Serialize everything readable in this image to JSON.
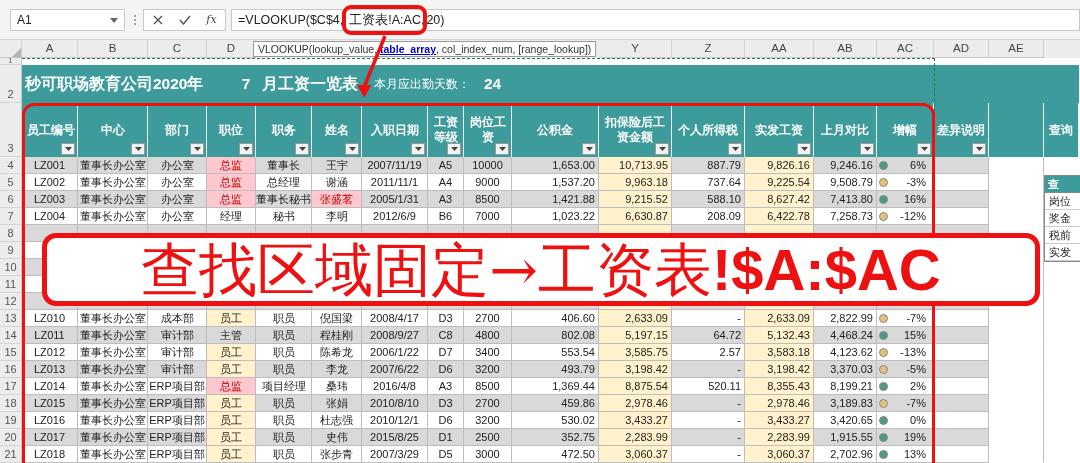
{
  "name_box": "A1",
  "formula_bar": {
    "function_button": "fx",
    "formula": "=VLOOKUP($C$4,工资表!A:AC,20)"
  },
  "tooltip": "VLOOKUP(lookup_value, **table_array**, col_index_num, [range_lookup])",
  "sheet": {
    "columns": [
      {
        "letter": "A",
        "header": "员工编号",
        "filter": true
      },
      {
        "letter": "B",
        "header": "中心",
        "filter": true
      },
      {
        "letter": "C",
        "header": "部门",
        "filter": true
      },
      {
        "letter": "D",
        "header": "职位",
        "filter": true
      },
      {
        "header": "职务",
        "filter": true
      },
      {
        "header": "姓名",
        "filter": true
      },
      {
        "header": "入职日期",
        "filter": true
      },
      {
        "header": "工资等级",
        "filter": true
      },
      {
        "header": "岗位工资",
        "filter": true
      },
      {
        "header": "公积金",
        "filter": true
      },
      {
        "letter": "Y",
        "header": "扣保险后工资金额",
        "filter": true
      },
      {
        "letter": "Z",
        "header": "个人所得税",
        "filter": true
      },
      {
        "letter": "AA",
        "header": "实发工资",
        "filter": true
      },
      {
        "letter": "AB",
        "header": "上月对比",
        "filter": true
      },
      {
        "letter": "AC",
        "header": "增幅",
        "filter": true
      },
      {
        "letter": "AD",
        "header": "差异说明",
        "filter": true
      },
      {
        "letter": "AE",
        "filter": false
      },
      {
        "header": "查询",
        "filter": false
      }
    ],
    "row_numbers": [
      "1",
      "2",
      "3"
    ],
    "title": {
      "company": "秒可职场教育公司2020年",
      "month": "7",
      "label": "月工资一览表",
      "days_label": "本月应出勤天数：",
      "days": "24"
    },
    "rows": [
      {
        "kind": "data",
        "number": "4",
        "shaded": true,
        "id": "LZ001",
        "center": "董事长办公室",
        "dept": "办公室",
        "position": {
          "text": "总监",
          "color": "#ffc7ce",
          "alert": true
        },
        "duty": "董事长",
        "name": {
          "text": "王宇"
        },
        "hire_date": "2007/11/19",
        "grade": "A5",
        "base_pay": "10000",
        "fund": "1,653.00",
        "after_insurance": "10,713.95",
        "tax": "887.79",
        "net_pay": "9,826.16",
        "last_month": "9,246.16",
        "growth": {
          "text": "6%",
          "color": "#4e9a82"
        }
      },
      {
        "kind": "data",
        "number": "5",
        "shaded": false,
        "id": "LZ002",
        "center": "董事长办公室",
        "dept": "办公室",
        "position": {
          "text": "总监",
          "color": "#ffc7ce",
          "alert": true
        },
        "duty": "总经理",
        "name": {
          "text": "谢涵"
        },
        "hire_date": "2011/11/1",
        "grade": "A4",
        "base_pay": "9000",
        "fund": "1,537.20",
        "after_insurance": "9,963.18",
        "tax": "737.64",
        "net_pay": "9,225.54",
        "last_month": "9,508.79",
        "growth": {
          "text": "-3%",
          "color": "#e6c07a"
        }
      },
      {
        "kind": "data",
        "number": "6",
        "shaded": true,
        "id": "LZ003",
        "center": "董事长办公室",
        "dept": "办公室",
        "position": {
          "text": "总监",
          "color": "#ffc7ce",
          "alert": true
        },
        "duty": "董事长秘书",
        "name": {
          "text": "张盛茗",
          "color": "#ffc7ce",
          "alert": true
        },
        "hire_date": "2005/1/31",
        "grade": "A3",
        "base_pay": "8500",
        "fund": "1,421.88",
        "after_insurance": "9,215.52",
        "tax": "588.10",
        "net_pay": "8,627.42",
        "last_month": "7,413.80",
        "growth": {
          "text": "16%",
          "color": "#4e9a82"
        }
      },
      {
        "kind": "data",
        "number": "7",
        "shaded": false,
        "id": "LZ004",
        "center": "董事长办公室",
        "dept": "办公室",
        "position": {
          "text": "经理"
        },
        "duty": "秘书",
        "name": {
          "text": "李明"
        },
        "hire_date": "2012/6/9",
        "grade": "B6",
        "base_pay": "7000",
        "fund": "1,023.22",
        "after_insurance": "6,630.87",
        "tax": "208.09",
        "net_pay": "6,422.78",
        "last_month": "7,258.73",
        "growth": {
          "text": "-12%",
          "color": "#e6c07a"
        }
      },
      {
        "kind": "covered",
        "number": "8",
        "shaded": true
      },
      {
        "kind": "covered",
        "number": "9",
        "shaded": false
      },
      {
        "kind": "covered",
        "number": "10",
        "shaded": true
      },
      {
        "kind": "covered",
        "number": "11",
        "shaded": false
      },
      {
        "kind": "covered",
        "number": "12",
        "shaded": true
      },
      {
        "kind": "data",
        "number": "13",
        "shaded": false,
        "id": "LZ010",
        "center": "董事长办公室",
        "dept": "成本部",
        "position": {
          "text": "员工",
          "color": "#fff2cc"
        },
        "duty": "职员",
        "name": {
          "text": "倪国梁"
        },
        "hire_date": "2008/4/17",
        "grade": "D3",
        "base_pay": "2700",
        "fund": "406.60",
        "after_insurance": "2,633.09",
        "tax": "-",
        "net_pay": "2,633.09",
        "last_month": "2,822.99",
        "growth": {
          "text": "-7%",
          "color": "#e6c07a"
        }
      },
      {
        "kind": "data",
        "number": "14",
        "shaded": true,
        "id": "LZ011",
        "center": "董事长办公室",
        "dept": "审计部",
        "position": {
          "text": "主管"
        },
        "duty": "职员",
        "name": {
          "text": "程桂刚"
        },
        "hire_date": "2008/9/27",
        "grade": "C8",
        "base_pay": "4800",
        "fund": "802.08",
        "after_insurance": "5,197.15",
        "tax": "64.72",
        "net_pay": "5,132.43",
        "last_month": "4,468.24",
        "growth": {
          "text": "15%",
          "color": "#4e9a82"
        }
      },
      {
        "kind": "data",
        "number": "15",
        "shaded": false,
        "id": "LZ012",
        "center": "董事长办公室",
        "dept": "审计部",
        "position": {
          "text": "员工",
          "color": "#fff2cc"
        },
        "duty": "职员",
        "name": {
          "text": "陈希龙"
        },
        "hire_date": "2006/1/22",
        "grade": "D7",
        "base_pay": "3400",
        "fund": "553.54",
        "after_insurance": "3,585.75",
        "tax": "2.57",
        "net_pay": "3,583.18",
        "last_month": "4,123.62",
        "growth": {
          "text": "-13%",
          "color": "#e6c07a"
        }
      },
      {
        "kind": "data",
        "number": "16",
        "shaded": true,
        "id": "LZ013",
        "center": "董事长办公室",
        "dept": "审计部",
        "position": {
          "text": "员工",
          "color": "#fff2cc"
        },
        "duty": "职员",
        "name": {
          "text": "李龙"
        },
        "hire_date": "2007/6/22",
        "grade": "D6",
        "base_pay": "3200",
        "fund": "493.79",
        "after_insurance": "3,198.42",
        "tax": "-",
        "net_pay": "3,198.42",
        "last_month": "3,370.03",
        "growth": {
          "text": "-5%",
          "color": "#e6c07a"
        }
      },
      {
        "kind": "data",
        "number": "17",
        "shaded": false,
        "id": "LZ014",
        "center": "董事长办公室",
        "dept": "ERP项目部",
        "position": {
          "text": "总监",
          "color": "#ffc7ce",
          "alert": true
        },
        "duty": "项目经理",
        "name": {
          "text": "桑玮"
        },
        "hire_date": "2016/4/8",
        "grade": "A3",
        "base_pay": "8500",
        "fund": "1,369.44",
        "after_insurance": "8,875.54",
        "tax": "520.11",
        "net_pay": "8,355.43",
        "last_month": "8,199.21",
        "growth": {
          "text": "2%",
          "color": "#4e9a82"
        }
      },
      {
        "kind": "data",
        "number": "18",
        "shaded": true,
        "id": "LZ015",
        "center": "董事长办公室",
        "dept": "ERP项目部",
        "position": {
          "text": "员工",
          "color": "#fff2cc"
        },
        "duty": "职员",
        "name": {
          "text": "张娟"
        },
        "hire_date": "2010/8/10",
        "grade": "D3",
        "base_pay": "2700",
        "fund": "459.86",
        "after_insurance": "2,978.46",
        "tax": "-",
        "net_pay": "2,978.46",
        "last_month": "3,189.83",
        "growth": {
          "text": "-7%",
          "color": "#e6c07a"
        }
      },
      {
        "kind": "data",
        "number": "19",
        "shaded": false,
        "id": "LZ016",
        "center": "董事长办公室",
        "dept": "ERP项目部",
        "position": {
          "text": "员工",
          "color": "#fff2cc"
        },
        "duty": "职员",
        "name": {
          "text": "杜志强"
        },
        "hire_date": "2010/12/1",
        "grade": "D6",
        "base_pay": "3200",
        "fund": "530.02",
        "after_insurance": "3,433.27",
        "tax": "-",
        "net_pay": "3,433.27",
        "last_month": "3,420.65",
        "growth": {
          "text": "0%",
          "color": "#4e9a82"
        }
      },
      {
        "kind": "data",
        "number": "20",
        "shaded": true,
        "id": "LZ017",
        "center": "董事长办公室",
        "dept": "ERP项目部",
        "position": {
          "text": "员工",
          "color": "#fff2cc"
        },
        "duty": "职员",
        "name": {
          "text": "史伟"
        },
        "hire_date": "2015/8/25",
        "grade": "D1",
        "base_pay": "2500",
        "fund": "352.75",
        "after_insurance": "2,283.99",
        "tax": "-",
        "net_pay": "2,283.99",
        "last_month": "1,915.55",
        "growth": {
          "text": "19%",
          "color": "#4e9a82"
        }
      },
      {
        "kind": "data",
        "number": "21",
        "shaded": false,
        "id": "LZ018",
        "center": "董事长办公室",
        "dept": "ERP项目部",
        "position": {
          "text": "员工",
          "color": "#fff2cc"
        },
        "duty": "职员",
        "name": {
          "text": "张步青"
        },
        "hire_date": "2007/3/29",
        "grade": "D5",
        "base_pay": "3000",
        "fund": "472.50",
        "after_insurance": "3,060.37",
        "tax": "-",
        "net_pay": "3,060.37",
        "last_month": "2,702.96",
        "growth": {
          "text": "13%",
          "color": "#4e9a82"
        }
      }
    ],
    "lookup_panel": {
      "header": "查",
      "items": [
        "岗位",
        "奖金",
        "税前",
        "实发"
      ]
    }
  },
  "callout": "查找区域固定→工资表**!$A:$AC**"
}
